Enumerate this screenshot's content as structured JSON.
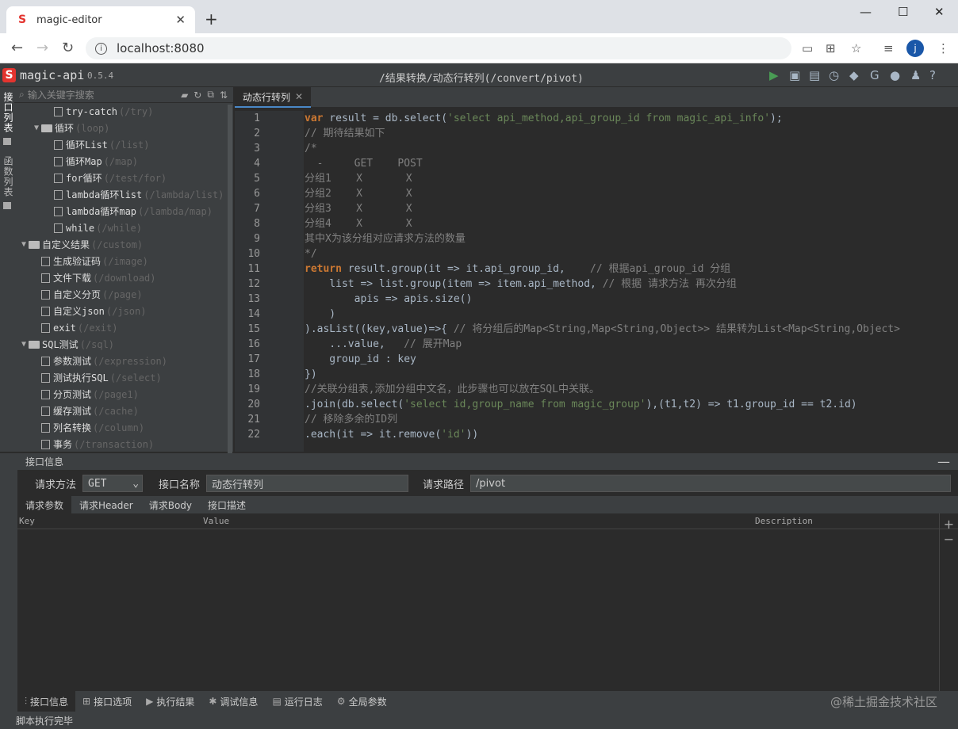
{
  "browser": {
    "tab_title": "magic-editor",
    "tab_close": "✕",
    "new_tab": "+",
    "url": "localhost:8080",
    "avatar_letter": "j"
  },
  "app": {
    "name": "magic-api",
    "version": "0.5.4",
    "title": "/结果转换/动态行转列(/convert/pivot)"
  },
  "vtabs": [
    "接口列表",
    "函数列表"
  ],
  "sidebar": {
    "search_placeholder": "输入关键字搜索",
    "items": [
      {
        "level": 2,
        "type": "file",
        "label": "try-catch",
        "path": "(/try)"
      },
      {
        "level": 1,
        "type": "folder",
        "label": "循环",
        "path": "(loop)"
      },
      {
        "level": 2,
        "type": "file",
        "label": "循环List",
        "path": "(/list)"
      },
      {
        "level": 2,
        "type": "file",
        "label": "循环Map",
        "path": "(/map)"
      },
      {
        "level": 2,
        "type": "file",
        "label": "for循环",
        "path": "(/test/for)"
      },
      {
        "level": 2,
        "type": "file",
        "label": "lambda循环list",
        "path": "(/lambda/list)"
      },
      {
        "level": 2,
        "type": "file",
        "label": "lambda循环map",
        "path": "(/lambda/map)"
      },
      {
        "level": 2,
        "type": "file",
        "label": "while",
        "path": "(/while)"
      },
      {
        "level": 0,
        "type": "folder",
        "label": "自定义结果",
        "path": "(/custom)"
      },
      {
        "level": 1,
        "type": "file",
        "label": "生成验证码",
        "path": "(/image)"
      },
      {
        "level": 1,
        "type": "file",
        "label": "文件下载",
        "path": "(/download)"
      },
      {
        "level": 1,
        "type": "file",
        "label": "自定义分页",
        "path": "(/page)"
      },
      {
        "level": 1,
        "type": "file",
        "label": "自定义json",
        "path": "(/json)"
      },
      {
        "level": 1,
        "type": "file",
        "label": "exit",
        "path": "(/exit)"
      },
      {
        "level": 0,
        "type": "folder",
        "label": "SQL测试",
        "path": "(/sql)"
      },
      {
        "level": 1,
        "type": "file",
        "label": "参数测试",
        "path": "(/expression)"
      },
      {
        "level": 1,
        "type": "file",
        "label": "测试执行SQL",
        "path": "(/select)"
      },
      {
        "level": 1,
        "type": "file",
        "label": "分页测试",
        "path": "(/page1)"
      },
      {
        "level": 1,
        "type": "file",
        "label": "缓存测试",
        "path": "(/cache)"
      },
      {
        "level": 1,
        "type": "file",
        "label": "列名转换",
        "path": "(/column)"
      },
      {
        "level": 1,
        "type": "file",
        "label": "事务",
        "path": "(/transaction)"
      }
    ]
  },
  "editor": {
    "tab_label": "动态行转列",
    "tab_close": "✕",
    "line_numbers": [
      "1",
      "2",
      "3",
      "4",
      "5",
      "6",
      "7",
      "8",
      "9",
      "10",
      "11",
      "12",
      "13",
      "14",
      "15",
      "16",
      "17",
      "18",
      "19",
      "20",
      "21",
      "22"
    ]
  },
  "info_panel": {
    "title": "接口信息",
    "minimize": "—",
    "method_label": "请求方法",
    "method_value": "GET",
    "name_label": "接口名称",
    "name_value": "动态行转列",
    "path_label": "请求路径",
    "path_value": "/pivot",
    "tabs": [
      "请求参数",
      "请求Header",
      "请求Body",
      "接口描述"
    ],
    "columns": [
      "Key",
      "Value",
      "Description"
    ],
    "add": "+",
    "remove": "−"
  },
  "bottom_tabs": [
    "接口信息",
    "接口选项",
    "执行结果",
    "调试信息",
    "运行日志",
    "全局参数"
  ],
  "watermark": "@稀土掘金技术社区",
  "status": "脚本执行完毕"
}
